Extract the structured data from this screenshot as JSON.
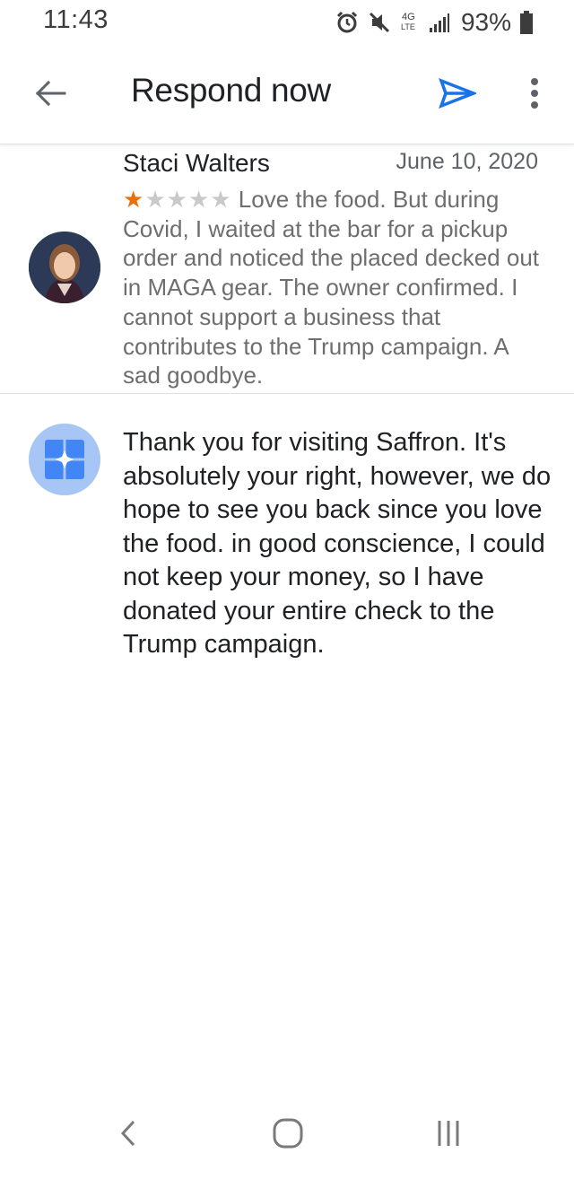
{
  "status_bar": {
    "time": "11:43",
    "battery_percent": "93%",
    "icons": [
      "alarm-icon",
      "mute-icon",
      "4g-lte-icon",
      "signal-icon",
      "battery-icon"
    ]
  },
  "app_bar": {
    "title": "Respond now",
    "back_icon": "arrow-back-icon",
    "send_icon": "send-icon",
    "more_icon": "more-vert-icon"
  },
  "review": {
    "reviewer_name": "Staci Walters",
    "date": "June 10, 2020",
    "rating": 1,
    "max_rating": 5,
    "text": "Love the food. But during Covid, I waited at the bar for a pickup order and noticed the placed decked out in MAGA gear. The owner confirmed.  I cannot support a business that contributes to the Trump campaign. A sad goodbye."
  },
  "reply": {
    "text": "Thank you for visiting Saffron. It's absolutely your right, however, we do hope to see you back since you love the food. in good conscience, I could not keep your money, so I have donated your entire check to the Trump campaign."
  },
  "nav_bar": {
    "icons": [
      "nav-back-icon",
      "nav-home-icon",
      "nav-recents-icon"
    ]
  },
  "colors": {
    "accent_blue": "#1a73e8",
    "star_orange": "#e8710a",
    "business_icon_bg": "#a7c6f6",
    "business_icon_fg": "#4285f4"
  }
}
